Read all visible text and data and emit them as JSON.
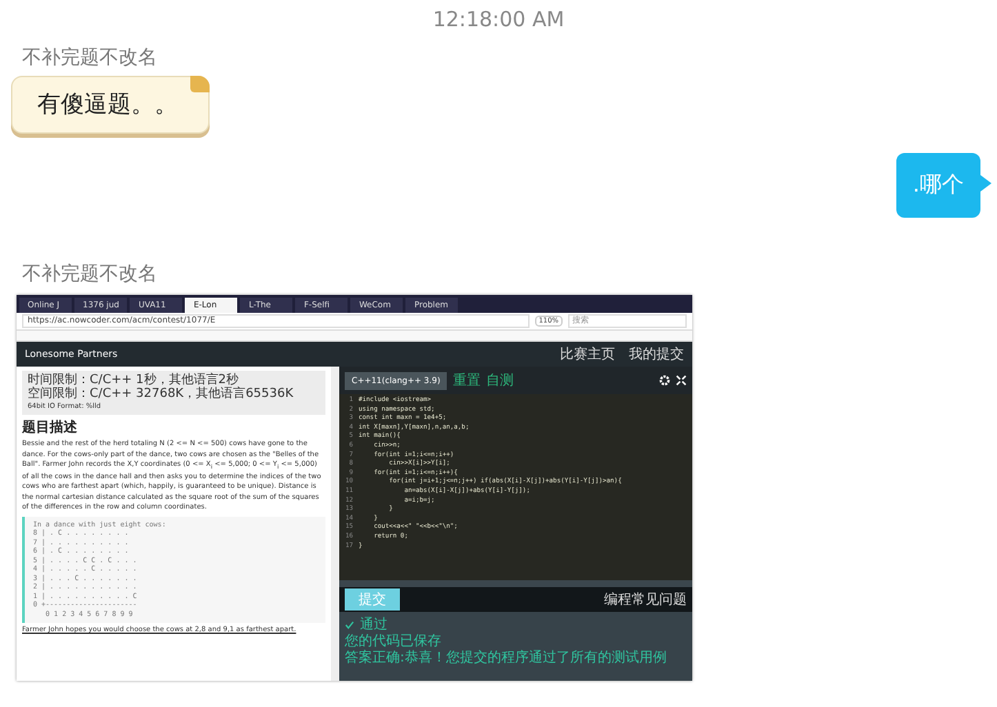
{
  "timestamp": "12:18:00 AM",
  "messages": [
    {
      "kind": "received",
      "sender": "不补完题不改名",
      "text": "有傻逼题。。"
    },
    {
      "kind": "sent",
      "text": ".哪个"
    },
    {
      "kind": "received_shot",
      "sender": "不补完题不改名",
      "screenshot": {
        "tabs": [
          {
            "label": "Online J",
            "selected": false
          },
          {
            "label": "1376 jud",
            "selected": false
          },
          {
            "label": "UVA11",
            "selected": false
          },
          {
            "label": "E-Lon",
            "selected": true
          },
          {
            "label": "L-The",
            "selected": false
          },
          {
            "label": "F-Selfi",
            "selected": false
          },
          {
            "label": "WeCom",
            "selected": false
          },
          {
            "label": "Problem",
            "selected": false
          }
        ],
        "url": "https://ac.nowcoder.com/acm/contest/1077/E",
        "zoom": "110%",
        "search_placeholder": "搜索",
        "title": "Lonesome Partners",
        "nav": [
          "比赛主页",
          "我的提交"
        ],
        "limits": [
          "时间限制：C/C++ 1秒，其他语言2秒",
          "空间限制：C/C++ 32768K，其他语言65536K",
          "64bit IO Format: %lld"
        ],
        "section_title": "题目描述",
        "description": "Bessie and the rest of the herd totaling N (2 <= N <= 500) cows have gone to the dance. For the cows-only part of the dance, two cows are chosen as the \"Belles of the Ball\". Farmer John records the X,Y coordinates (0 <= X$_{i}$ <= 5,000; 0 <= Y$_{i}$ <= 5,000) of all the cows in the dance hall and then asks you to determine the indices of the two cows who are farthest apart (which, happily, is guaranteed to be unique). Distance is the normal cartesian distance calculated as the square root of the sum of the squares of the differences in the row and column coordinates.",
        "sample": [
          "In a dance with just eight cows:",
          "8 | . C . . . . . . . .",
          "7 | . . . . . . . . . .",
          "6 | . C . . . . . . . .",
          "5 | . . . . C C . C . . .",
          "4 | . . . . . C . . . . .",
          "3 | . . . C . . . . . . .",
          "2 | . . . . . . . . . . .",
          "1 | . . . . . . . . . . C",
          "0 +----------------------",
          "   0 1 2 3 4 5 6 7 8 9 9"
        ],
        "footer_line": "Farmer John hopes you would choose the cows at 2,8 and 9,1 as farthest apart.",
        "language": "C++11(clang++ 3.9)",
        "actions": [
          "重置",
          "自测"
        ],
        "code": [
          {
            "no": "1",
            "text": "#include <iostream>"
          },
          {
            "no": "2",
            "text": "using namespace std;"
          },
          {
            "no": "3",
            "text": "const int maxn = 1e4+5;"
          },
          {
            "no": "4",
            "text": "int X[maxn],Y[maxn],n,an,a,b;"
          },
          {
            "no": "5",
            "text": "int main(){"
          },
          {
            "no": "6",
            "text": "    cin>>n;"
          },
          {
            "no": "7",
            "text": "    for(int i=1;i<=n;i++)"
          },
          {
            "no": "8",
            "text": "        cin>>X[i]>>Y[i];"
          },
          {
            "no": "9",
            "text": "    for(int i=1;i<=n;i++){"
          },
          {
            "no": "10",
            "text": "        for(int j=i+1;j<=n;j++) if(abs(X[i]-X[j])+abs(Y[i]-Y[j])>an){"
          },
          {
            "no": "11",
            "text": "            an=abs(X[i]-X[j])+abs(Y[i]-Y[j]);"
          },
          {
            "no": "12",
            "text": "            a=i;b=j;"
          },
          {
            "no": "13",
            "text": "        }"
          },
          {
            "no": "14",
            "text": "    }"
          },
          {
            "no": "15",
            "text": "    cout<<a<<\" \"<<b<<\"\\n\";"
          },
          {
            "no": "16",
            "text": "    return 0;"
          },
          {
            "no": "17",
            "text": "}"
          }
        ],
        "submit": "提交",
        "help": "编程常见问题",
        "result_status": "通过",
        "result_lines": [
          "您的代码已保存",
          "答案正确:恭喜！您提交的程序通过了所有的测试用例"
        ]
      }
    }
  ]
}
